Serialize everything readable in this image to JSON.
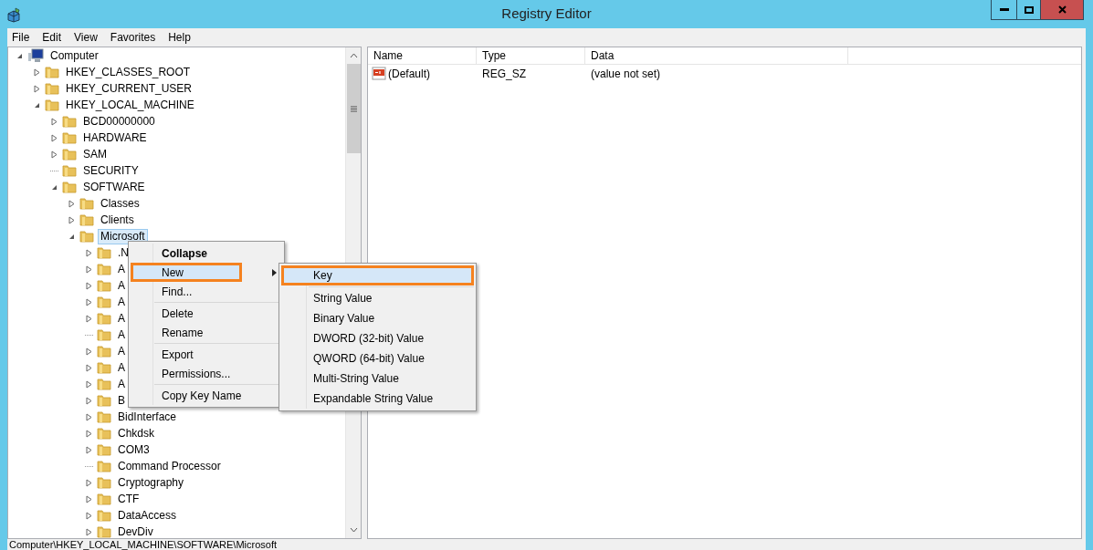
{
  "window": {
    "title": "Registry Editor"
  },
  "menu_bar": [
    "File",
    "Edit",
    "View",
    "Favorites",
    "Help"
  ],
  "tree": [
    {
      "label": "Computer",
      "kind": "computer",
      "expandable": true,
      "expanded": true,
      "selected": false,
      "children": [
        {
          "label": "HKEY_CLASSES_ROOT",
          "expandable": true,
          "expanded": false,
          "selected": false
        },
        {
          "label": "HKEY_CURRENT_USER",
          "expandable": true,
          "expanded": false,
          "selected": false
        },
        {
          "label": "HKEY_LOCAL_MACHINE",
          "expandable": true,
          "expanded": true,
          "selected": false,
          "children": [
            {
              "label": "BCD00000000",
              "expandable": true,
              "expanded": false,
              "selected": false
            },
            {
              "label": "HARDWARE",
              "expandable": true,
              "expanded": false,
              "selected": false
            },
            {
              "label": "SAM",
              "expandable": true,
              "expanded": false,
              "selected": false
            },
            {
              "label": "SECURITY",
              "expandable": false,
              "expanded": false,
              "selected": false
            },
            {
              "label": "SOFTWARE",
              "expandable": true,
              "expanded": true,
              "selected": false,
              "children": [
                {
                  "label": "Classes",
                  "expandable": true,
                  "expanded": false,
                  "selected": false
                },
                {
                  "label": "Clients",
                  "expandable": true,
                  "expanded": false,
                  "selected": false
                },
                {
                  "label": "Microsoft",
                  "expandable": true,
                  "expanded": true,
                  "selected": true,
                  "children": [
                    {
                      "label": ".N",
                      "expandable": true,
                      "expanded": false,
                      "selected": false
                    },
                    {
                      "label": "A",
                      "expandable": true,
                      "expanded": false,
                      "selected": false
                    },
                    {
                      "label": "A",
                      "expandable": true,
                      "expanded": false,
                      "selected": false
                    },
                    {
                      "label": "A",
                      "expandable": true,
                      "expanded": false,
                      "selected": false
                    },
                    {
                      "label": "A",
                      "expandable": true,
                      "expanded": false,
                      "selected": false
                    },
                    {
                      "label": "A",
                      "expandable": false,
                      "expanded": false,
                      "selected": false
                    },
                    {
                      "label": "A",
                      "expandable": true,
                      "expanded": false,
                      "selected": false
                    },
                    {
                      "label": "A",
                      "expandable": true,
                      "expanded": false,
                      "selected": false
                    },
                    {
                      "label": "A",
                      "expandable": true,
                      "expanded": false,
                      "selected": false
                    },
                    {
                      "label": "B",
                      "expandable": true,
                      "expanded": false,
                      "selected": false
                    },
                    {
                      "label": "BidInterface",
                      "expandable": true,
                      "expanded": false,
                      "selected": false
                    },
                    {
                      "label": "Chkdsk",
                      "expandable": true,
                      "expanded": false,
                      "selected": false
                    },
                    {
                      "label": "COM3",
                      "expandable": true,
                      "expanded": false,
                      "selected": false
                    },
                    {
                      "label": "Command Processor",
                      "expandable": false,
                      "expanded": false,
                      "selected": false
                    },
                    {
                      "label": "Cryptography",
                      "expandable": true,
                      "expanded": false,
                      "selected": false
                    },
                    {
                      "label": "CTF",
                      "expandable": true,
                      "expanded": false,
                      "selected": false
                    },
                    {
                      "label": "DataAccess",
                      "expandable": true,
                      "expanded": false,
                      "selected": false
                    },
                    {
                      "label": "DevDiv",
                      "expandable": true,
                      "expanded": false,
                      "selected": false
                    }
                  ]
                }
              ]
            }
          ]
        }
      ]
    }
  ],
  "values": {
    "columns": [
      "Name",
      "Type",
      "Data"
    ],
    "rows": [
      {
        "name": "(Default)",
        "type": "REG_SZ",
        "data": "(value not set)"
      }
    ]
  },
  "context_menu": {
    "items": [
      {
        "kind": "item",
        "label": "Collapse",
        "bold": true,
        "selected": false,
        "outlined": false,
        "submenu": false
      },
      {
        "kind": "item",
        "label": "New",
        "bold": false,
        "selected": true,
        "outlined": true,
        "submenu": true
      },
      {
        "kind": "item",
        "label": "Find...",
        "bold": false,
        "selected": false,
        "outlined": false,
        "submenu": false
      },
      {
        "kind": "separator"
      },
      {
        "kind": "item",
        "label": "Delete",
        "bold": false,
        "selected": false,
        "outlined": false,
        "submenu": false
      },
      {
        "kind": "item",
        "label": "Rename",
        "bold": false,
        "selected": false,
        "outlined": false,
        "submenu": false
      },
      {
        "kind": "separator"
      },
      {
        "kind": "item",
        "label": "Export",
        "bold": false,
        "selected": false,
        "outlined": false,
        "submenu": false
      },
      {
        "kind": "item",
        "label": "Permissions...",
        "bold": false,
        "selected": false,
        "outlined": false,
        "submenu": false
      },
      {
        "kind": "separator"
      },
      {
        "kind": "item",
        "label": "Copy Key Name",
        "bold": false,
        "selected": false,
        "outlined": false,
        "submenu": false
      }
    ]
  },
  "submenu": {
    "items": [
      {
        "kind": "item",
        "label": "Key",
        "selected": true,
        "outlined": true
      },
      {
        "kind": "separator"
      },
      {
        "kind": "item",
        "label": "String Value",
        "selected": false,
        "outlined": false
      },
      {
        "kind": "item",
        "label": "Binary Value",
        "selected": false,
        "outlined": false
      },
      {
        "kind": "item",
        "label": "DWORD (32-bit) Value",
        "selected": false,
        "outlined": false
      },
      {
        "kind": "item",
        "label": "QWORD (64-bit) Value",
        "selected": false,
        "outlined": false
      },
      {
        "kind": "item",
        "label": "Multi-String Value",
        "selected": false,
        "outlined": false
      },
      {
        "kind": "item",
        "label": "Expandable String Value",
        "selected": false,
        "outlined": false
      }
    ]
  },
  "status_bar": "Computer\\HKEY_LOCAL_MACHINE\\SOFTWARE\\Microsoft"
}
